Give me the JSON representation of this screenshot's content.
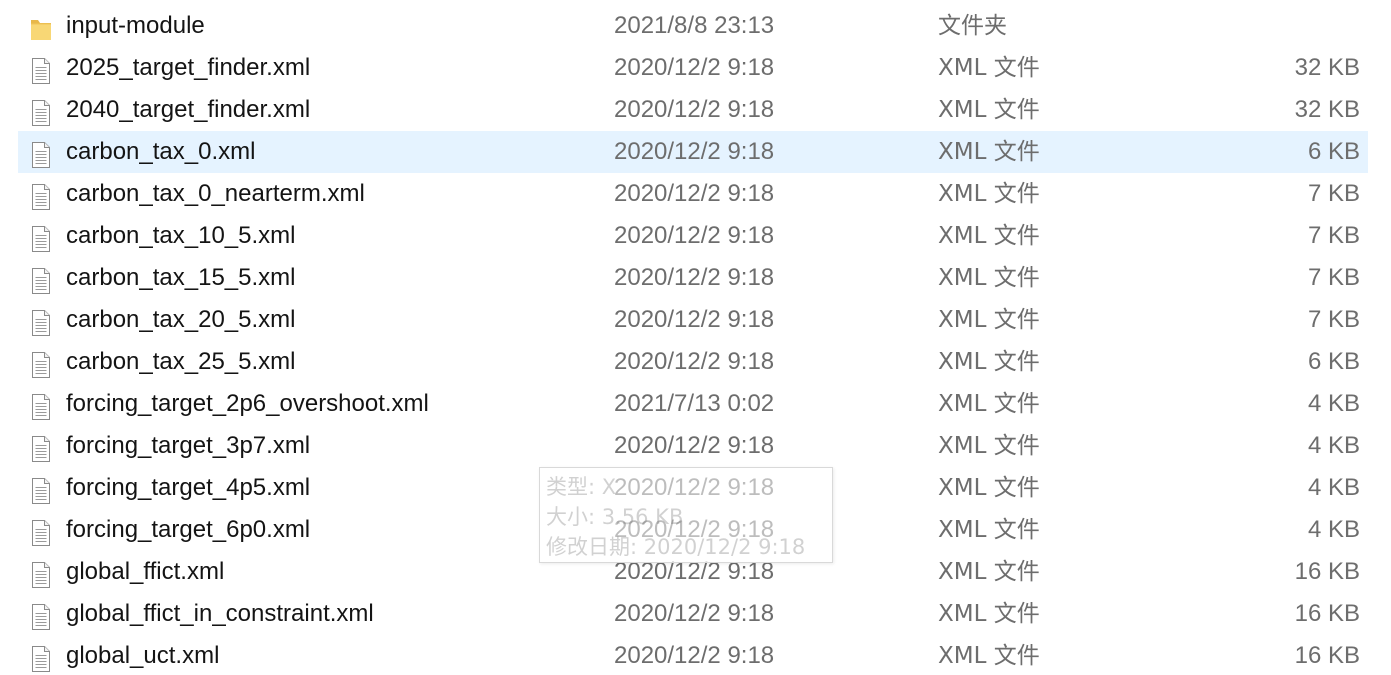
{
  "colors": {
    "selected_row_bg": "#e5f3ff",
    "secondary_text": "#6d6d6d",
    "folder_yellow": "#f8d775"
  },
  "files": [
    {
      "icon": "folder-icon",
      "name": "input-module",
      "date": "2021/8/8 23:13",
      "type": "文件夹",
      "size": ""
    },
    {
      "icon": "xml-file-icon",
      "name": "2025_target_finder.xml",
      "date": "2020/12/2 9:18",
      "type": "XML 文件",
      "size": "32 KB"
    },
    {
      "icon": "xml-file-icon",
      "name": "2040_target_finder.xml",
      "date": "2020/12/2 9:18",
      "type": "XML 文件",
      "size": "32 KB"
    },
    {
      "icon": "xml-file-icon",
      "name": "carbon_tax_0.xml",
      "date": "2020/12/2 9:18",
      "type": "XML 文件",
      "size": "6 KB",
      "selected": true
    },
    {
      "icon": "xml-file-icon",
      "name": "carbon_tax_0_nearterm.xml",
      "date": "2020/12/2 9:18",
      "type": "XML 文件",
      "size": "7 KB"
    },
    {
      "icon": "xml-file-icon",
      "name": "carbon_tax_10_5.xml",
      "date": "2020/12/2 9:18",
      "type": "XML 文件",
      "size": "7 KB"
    },
    {
      "icon": "xml-file-icon",
      "name": "carbon_tax_15_5.xml",
      "date": "2020/12/2 9:18",
      "type": "XML 文件",
      "size": "7 KB"
    },
    {
      "icon": "xml-file-icon",
      "name": "carbon_tax_20_5.xml",
      "date": "2020/12/2 9:18",
      "type": "XML 文件",
      "size": "7 KB"
    },
    {
      "icon": "xml-file-icon",
      "name": "carbon_tax_25_5.xml",
      "date": "2020/12/2 9:18",
      "type": "XML 文件",
      "size": "6 KB"
    },
    {
      "icon": "xml-file-icon",
      "name": "forcing_target_2p6_overshoot.xml",
      "date": "2021/7/13 0:02",
      "type": "XML 文件",
      "size": "4 KB"
    },
    {
      "icon": "xml-file-icon",
      "name": "forcing_target_3p7.xml",
      "date": "2020/12/2 9:18",
      "type": "XML 文件",
      "size": "4 KB"
    },
    {
      "icon": "xml-file-icon",
      "name": "forcing_target_4p5.xml",
      "date": "2020/12/2 9:18",
      "type": "XML 文件",
      "size": "4 KB"
    },
    {
      "icon": "xml-file-icon",
      "name": "forcing_target_6p0.xml",
      "date": "2020/12/2 9:18",
      "type": "XML 文件",
      "size": "4 KB"
    },
    {
      "icon": "xml-file-icon",
      "name": "global_ffict.xml",
      "date": "2020/12/2 9:18",
      "type": "XML 文件",
      "size": "16 KB"
    },
    {
      "icon": "xml-file-icon",
      "name": "global_ffict_in_constraint.xml",
      "date": "2020/12/2 9:18",
      "type": "XML 文件",
      "size": "16 KB"
    },
    {
      "icon": "xml-file-icon",
      "name": "global_uct.xml",
      "date": "2020/12/2 9:18",
      "type": "XML 文件",
      "size": "16 KB"
    }
  ],
  "tooltip": {
    "type_line": "类型: X",
    "size_line": "大小: 3.56 KB",
    "modified_line": "修改日期: 2020/12/2 9:18"
  }
}
